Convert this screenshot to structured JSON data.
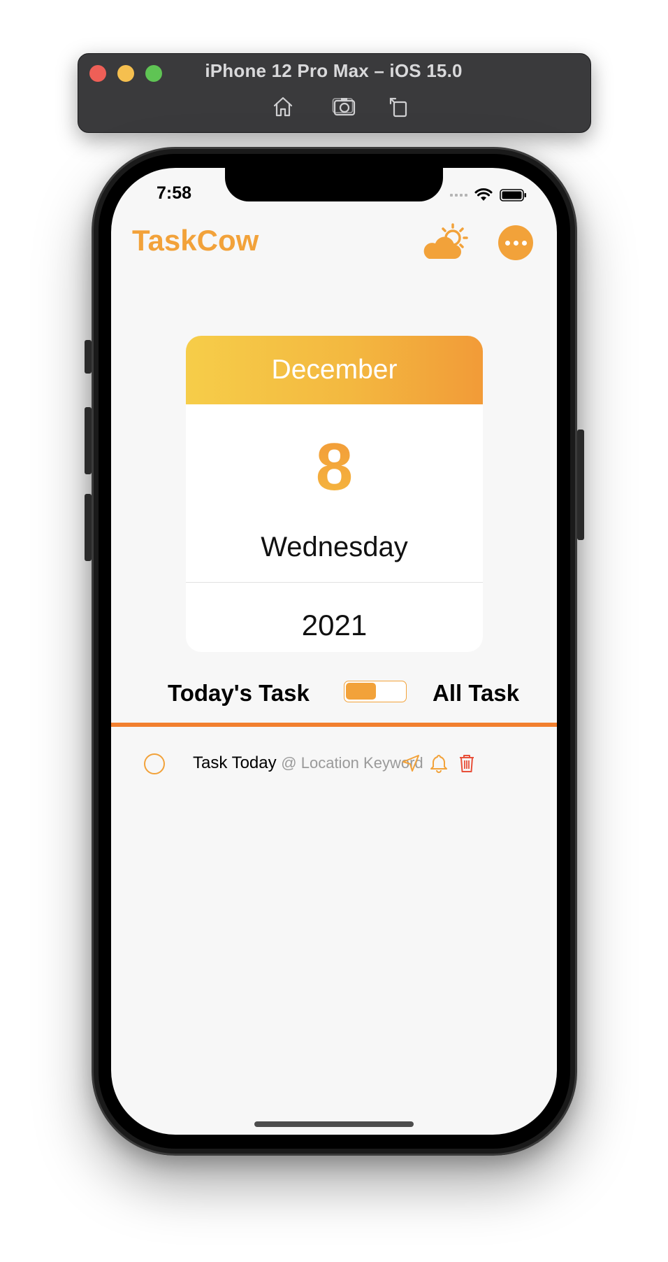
{
  "simulator": {
    "title": "iPhone 12 Pro Max – iOS 15.0",
    "icons": [
      "home-icon",
      "screenshot-icon",
      "rotate-icon"
    ]
  },
  "status_bar": {
    "time": "7:58",
    "icons": [
      "signal-icon",
      "wifi-icon",
      "battery-icon"
    ]
  },
  "header": {
    "title": "TaskCow",
    "weather_icon": "partly-cloudy-icon",
    "more_icon": "ellipsis-icon"
  },
  "calendar": {
    "month": "December",
    "day": "8",
    "weekday": "Wednesday",
    "year": "2021"
  },
  "task_toggle": {
    "left_label": "Today's Task",
    "right_label": "All Task",
    "selected": "Today's Task"
  },
  "tasks": [
    {
      "title": "Task Today",
      "location": "@ Location Keyword",
      "done": false,
      "actions": [
        "location-arrow-icon",
        "bell-icon",
        "trash-icon"
      ]
    }
  ],
  "colors": {
    "accent": "#f2a23a",
    "rule": "#f2802f",
    "delete": "#e8503a",
    "background": "#f7f7f7"
  }
}
